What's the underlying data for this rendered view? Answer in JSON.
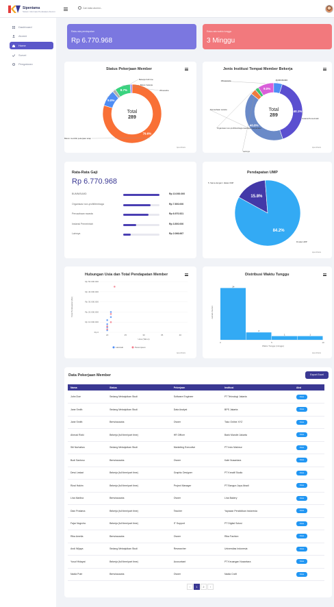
{
  "app": {
    "title": "Sipentama",
    "subtitle": "Sistem Informasi Pendataan Alumni"
  },
  "search": {
    "placeholder": "Cari data alumni..."
  },
  "sidebar": {
    "items": [
      {
        "label": "Dashboard",
        "icon": "grid-icon",
        "active": false
      },
      {
        "label": "Alumni",
        "icon": "users-icon",
        "active": false
      },
      {
        "label": "Home",
        "icon": "home-icon",
        "active": true
      },
      {
        "label": "Survei",
        "icon": "check-icon",
        "active": false
      },
      {
        "label": "Pengaturan",
        "icon": "gear-icon",
        "active": false
      }
    ]
  },
  "stats": [
    {
      "label": "Rata-rata pendapatan",
      "value": "Rp 6.770.968",
      "color": "#7b77e0"
    },
    {
      "label": "Rata-rata waktu tunggu",
      "value": "3 Minggu",
      "color": "#f2797d"
    }
  ],
  "status_chart": {
    "title": "Status Pekerjaan Member",
    "total_label": "Total",
    "total_value": "289",
    "watermark": "ApexCharts",
    "chart_data": {
      "type": "pie",
      "categories": [
        "Belum memiliki pekerjaan tetap",
        "Bekerja Full time",
        "Belum bekerja",
        "Wirausaha",
        "Bekerja Part time"
      ],
      "values": [
        230,
        26,
        5,
        25,
        3
      ],
      "colors": [
        "#f97036",
        "#4e8df5",
        "#b0b0b0",
        "#39d37f",
        "#9a93ff"
      ],
      "slice_labels": [
        "79.6%",
        "9.0%",
        "",
        "8.7%",
        ""
      ]
    }
  },
  "institution_chart": {
    "title": "Jenis Institusi Tempat Member Bekerja",
    "total_label": "Total",
    "total_value": "289",
    "watermark": "ApexCharts",
    "chart_data": {
      "type": "pie",
      "categories": [
        "Instansi Pemerintah",
        "Perusahaan swasta",
        "Organisasi non-profit/lembaga swadaya masyarakat",
        "Lainnya",
        "Wiraswasta",
        "BUMN/BUMD"
      ],
      "values": [
        116,
        118,
        9,
        6,
        26,
        14
      ],
      "colors": [
        "#5b4fd0",
        "#6a8ac8",
        "#f57a3a",
        "#3ec46d",
        "#d95fd9",
        "#4e8df5"
      ],
      "slice_labels": [
        "40.1%",
        "40.8%",
        "",
        "",
        "9.0%",
        ""
      ]
    }
  },
  "avg_salary": {
    "title": "Rata-Rata Gaji",
    "value": "Rp 6.770.968",
    "rows": [
      {
        "name": "BUMN/BUMD",
        "amount": "Rp 10.000.000",
        "fill": 1.0
      },
      {
        "name": "Organisasi non-profit/lembaga",
        "amount": "Rp 7.500.000",
        "fill": 0.75
      },
      {
        "name": "Perusahaan swasta",
        "amount": "Rp 6.970.521",
        "fill": 0.7
      },
      {
        "name": "Instansi Pemerintah",
        "amount": "Rp 3.500.000",
        "fill": 0.35
      },
      {
        "name": "Lainnya",
        "amount": "Rp 2.066.667",
        "fill": 0.21
      }
    ]
  },
  "ump_chart": {
    "title": "Pendapatan UMP",
    "watermark": "ApexCharts",
    "chart_data": {
      "type": "pie",
      "categories": [
        "Di bawah UMP",
        "Di atas UMP"
      ],
      "values": [
        15.8,
        84.2
      ],
      "colors": [
        "#4338a8",
        "#33aaf4"
      ],
      "slice_labels": [
        "15.8%",
        "84.2%"
      ],
      "legend_labels": [
        "5. Sama dengan / diatas UMP",
        "Di atas UMP"
      ]
    }
  },
  "scatter_chart": {
    "title": "Hubungan Usia dan Total Pendapatan Member",
    "watermark": "ApexCharts",
    "legend": [
      "Laki-laki",
      "Perempuan"
    ],
    "chart_data": {
      "type": "scatter",
      "ylabel": "Total Pendapatan (Rp)",
      "xlabel": "Usia (Tahun)",
      "yticks": [
        "Rp 50.000.000",
        "Rp 40.000.000",
        "Rp 30.000.000",
        "Rp 20.000.000",
        "Rp 10.000.000",
        "Rp 0"
      ],
      "xticks": [
        "20",
        "25",
        "30",
        "35",
        "40"
      ],
      "xlim": [
        18,
        42
      ],
      "ylim": [
        0,
        50000000
      ],
      "series": [
        {
          "name": "Laki-laki",
          "color": "#4e8df5",
          "x": [
            20,
            20,
            20,
            20,
            21,
            21
          ],
          "y": [
            2000000,
            5000000,
            8000000,
            12000000,
            15000000,
            20000000
          ]
        },
        {
          "name": "Perempuan",
          "color": "#f37a8a",
          "x": [
            20,
            20,
            21,
            21,
            22
          ],
          "y": [
            3000000,
            6000000,
            10000000,
            18000000,
            45000000
          ]
        }
      ]
    }
  },
  "wait_chart": {
    "title": "Distribusi Waktu Tunggu",
    "watermark": "ApexCharts",
    "chart_data": {
      "type": "bar",
      "xlabel": "Waktu Tunggu (minggu)",
      "ylabel": "Jumlah Alumni",
      "categories": [
        "0",
        "1",
        "2",
        "3"
      ],
      "values": [
        14,
        2,
        1,
        1
      ],
      "color": "#33aaf4",
      "data_labels": [
        "14",
        "2",
        "1",
        "1"
      ],
      "xticks": [
        "0",
        "5",
        "10"
      ],
      "ylim": [
        0,
        15
      ]
    }
  },
  "table": {
    "title": "Data Pekerjaan Member",
    "export_label": "Export Excel",
    "headers": [
      "Nama",
      "Status",
      "Pekerjaan",
      "Institusi",
      "Aksi"
    ],
    "view_label": "View",
    "rows": [
      [
        "John Doe",
        "Sedang Melanjutkan Studi",
        "Software Engineer",
        "PT Teknologi Jakarta",
        "View"
      ],
      [
        "Jane Smith",
        "Sedang Melanjutkan Studi",
        "Data Analyst",
        "BPS Jakarta",
        "View"
      ],
      [
        "Jane Smith",
        "Berwirausaha",
        "Owner",
        "Toko Online XYZ",
        "View"
      ],
      [
        "Ahmad Rizki",
        "Bekerja (full time/part time)",
        "HR Officer",
        "Bank Mandiri Jakarta",
        "View"
      ],
      [
        "Siti Nurhaliza",
        "Sedang Melanjutkan Studi",
        "Marketing Executive",
        "PT Indo Makmur",
        "View"
      ],
      [
        "Budi Santoso",
        "Berwirausaha",
        "Owner",
        "Kafe Nusantara",
        "View"
      ],
      [
        "Dewi Lestari",
        "Bekerja (full time/part time)",
        "Graphic Designer",
        "PT Kreatif Studio",
        "View"
      ],
      [
        "Rizal Hakim",
        "Bekerja (full time/part time)",
        "Project Manager",
        "PT Bangun Jaya Abadi",
        "View"
      ],
      [
        "Lina Marlina",
        "Berwirausaha",
        "Owner",
        "Lina Bakery",
        "View"
      ],
      [
        "Dian Pratama",
        "Bekerja (full time/part time)",
        "Teacher",
        "Yayasan Pendidikan Indonesia",
        "View"
      ],
      [
        "Fajar Nugroho",
        "Bekerja (full time/part time)",
        "IT Support",
        "PT Digital Solusi",
        "View"
      ],
      [
        "Rika Amelia",
        "Berwirausaha",
        "Owner",
        "Rika Fashion",
        "View"
      ],
      [
        "Andi Wijaya",
        "Sedang Melanjutkan Studi",
        "Researcher",
        "Universitas Indonesia",
        "View"
      ],
      [
        "Yusuf Hidayat",
        "Bekerja (full time/part time)",
        "Accountant",
        "PT Keuangan Nusantara",
        "View"
      ],
      [
        "Nadia Putri",
        "Berwirausaha",
        "Owner",
        "Nadia Craft",
        "View"
      ]
    ]
  },
  "pagination": [
    "‹",
    "1",
    "2",
    "›"
  ]
}
